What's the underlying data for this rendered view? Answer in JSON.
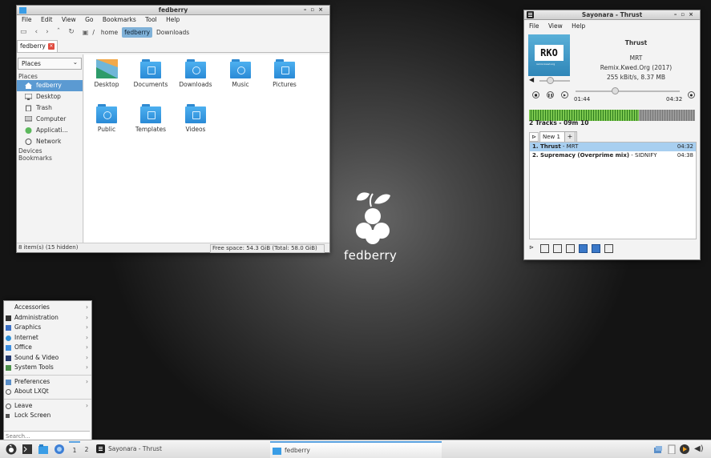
{
  "filemanager": {
    "title": "fedberry",
    "menu": [
      "File",
      "Edit",
      "View",
      "Go",
      "Bookmarks",
      "Tool",
      "Help"
    ],
    "breadcrumb": [
      "/",
      "home",
      "fedberry",
      "Downloads"
    ],
    "tab_label": "fedberry",
    "places_select": "Places",
    "side_headers": {
      "places": "Places",
      "devices": "Devices",
      "bookmarks": "Bookmarks"
    },
    "places": [
      {
        "label": "fedberry",
        "icon": "home-icon",
        "selected": true
      },
      {
        "label": "Desktop",
        "icon": "desktop-icon"
      },
      {
        "label": "Trash",
        "icon": "trash-icon"
      },
      {
        "label": "Computer",
        "icon": "computer-icon"
      },
      {
        "label": "Applicati...",
        "icon": "applications-icon"
      },
      {
        "label": "Network",
        "icon": "network-icon"
      }
    ],
    "items": [
      {
        "label": "Desktop",
        "icon": "desktop-folder-icon"
      },
      {
        "label": "Documents",
        "icon": "documents-folder-icon"
      },
      {
        "label": "Downloads",
        "icon": "downloads-folder-icon"
      },
      {
        "label": "Music",
        "icon": "music-folder-icon"
      },
      {
        "label": "Pictures",
        "icon": "pictures-folder-icon"
      },
      {
        "label": "Public",
        "icon": "public-folder-icon"
      },
      {
        "label": "Templates",
        "icon": "templates-folder-icon"
      },
      {
        "label": "Videos",
        "icon": "videos-folder-icon"
      }
    ],
    "status_left": "8 item(s) (15 hidden)",
    "status_right": "Free space: 54.3 GiB (Total: 58.0 GiB)"
  },
  "player": {
    "title": "Sayonara - Thrust",
    "menu": [
      "File",
      "View",
      "Help"
    ],
    "cover_text": "RKO",
    "cover_sub": "remix.kwed.org",
    "track_title": "Thrust",
    "artist": "MRT",
    "album": "Remix.Kwed.Org (2017)",
    "bitrate": "255 kBit/s, 8.37 MB",
    "time_current": "01:44",
    "time_total": "04:32",
    "progress_fraction": 0.38,
    "volume_fraction": 0.35,
    "summary": "2 Tracks - 09m 10",
    "playlist_tab": "New 1",
    "playlist_add": "+",
    "tracks": [
      {
        "num": "1.",
        "title": "Thrust",
        "artist": "MRT",
        "duration": "04:32",
        "selected": true
      },
      {
        "num": "2.",
        "title": "Supremacy (Overprime mix)",
        "artist": "SIDNIFY",
        "duration": "04:38"
      }
    ]
  },
  "desktop": {
    "logo_text": "fedberry"
  },
  "startmenu": {
    "items": [
      {
        "label": "Accessories",
        "submenu": true,
        "icon": "accessories-icon"
      },
      {
        "label": "Administration",
        "submenu": true,
        "icon": "administration-icon"
      },
      {
        "label": "Graphics",
        "submenu": true,
        "icon": "graphics-icon"
      },
      {
        "label": "Internet",
        "submenu": true,
        "icon": "internet-icon"
      },
      {
        "label": "Office",
        "submenu": true,
        "icon": "office-icon"
      },
      {
        "label": "Sound & Video",
        "submenu": true,
        "icon": "sound-video-icon"
      },
      {
        "label": "System Tools",
        "submenu": true,
        "icon": "system-tools-icon"
      }
    ],
    "items2": [
      {
        "label": "Preferences",
        "submenu": true,
        "icon": "preferences-icon"
      },
      {
        "label": "About LXQt",
        "icon": "about-icon"
      }
    ],
    "items3": [
      {
        "label": "Leave",
        "submenu": true,
        "icon": "leave-icon"
      },
      {
        "label": "Lock Screen",
        "icon": "lock-icon"
      }
    ],
    "search_placeholder": "Search..."
  },
  "taskbar": {
    "desktops": [
      "1",
      "2"
    ],
    "tasks": [
      {
        "label": "Sayonara - Thrust",
        "active": false
      },
      {
        "label": "fedberry",
        "active": true
      }
    ]
  },
  "colors": {
    "selection": "#5b9ad2",
    "folder": "#3a9de6",
    "accent": "#5aa2e0"
  }
}
